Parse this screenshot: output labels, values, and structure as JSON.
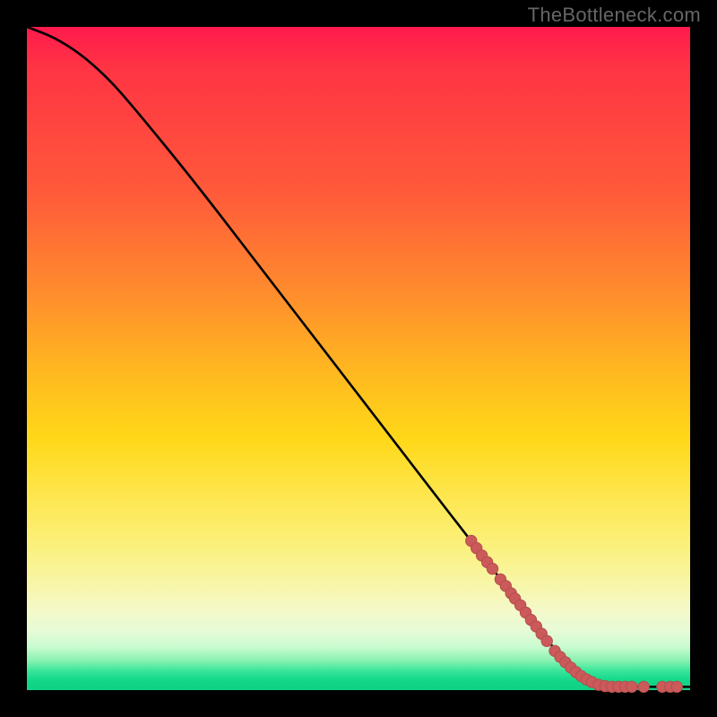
{
  "watermark": "TheBottleneck.com",
  "colors": {
    "curve_stroke": "#000000",
    "dot_fill": "#cc5a5a",
    "dot_stroke": "#b24e4e",
    "gradient_top": "#ff1a4d",
    "gradient_bottom": "#10d185"
  },
  "chart_data": {
    "type": "line",
    "title": "",
    "xlabel": "",
    "ylabel": "",
    "xlim": [
      0,
      100
    ],
    "ylim": [
      0,
      100
    ],
    "curve": [
      {
        "x": 0,
        "y": 100
      },
      {
        "x": 4,
        "y": 98.5
      },
      {
        "x": 8,
        "y": 96
      },
      {
        "x": 12,
        "y": 92.5
      },
      {
        "x": 16,
        "y": 88
      },
      {
        "x": 25,
        "y": 77
      },
      {
        "x": 35,
        "y": 64
      },
      {
        "x": 45,
        "y": 51
      },
      {
        "x": 55,
        "y": 38
      },
      {
        "x": 65,
        "y": 25
      },
      {
        "x": 72,
        "y": 16
      },
      {
        "x": 78,
        "y": 8
      },
      {
        "x": 82,
        "y": 3.5
      },
      {
        "x": 85,
        "y": 1.2
      },
      {
        "x": 88,
        "y": 0.5
      },
      {
        "x": 92,
        "y": 0.5
      },
      {
        "x": 96,
        "y": 0.5
      },
      {
        "x": 100,
        "y": 0.5
      }
    ],
    "dots": [
      {
        "x": 67.0,
        "y": 22.5
      },
      {
        "x": 67.8,
        "y": 21.4
      },
      {
        "x": 68.6,
        "y": 20.3
      },
      {
        "x": 69.4,
        "y": 19.3
      },
      {
        "x": 70.2,
        "y": 18.3
      },
      {
        "x": 71.4,
        "y": 16.7
      },
      {
        "x": 72.2,
        "y": 15.7
      },
      {
        "x": 73.0,
        "y": 14.6
      },
      {
        "x": 73.6,
        "y": 13.8
      },
      {
        "x": 74.4,
        "y": 12.8
      },
      {
        "x": 75.2,
        "y": 11.7
      },
      {
        "x": 76.0,
        "y": 10.6
      },
      {
        "x": 76.8,
        "y": 9.6
      },
      {
        "x": 77.6,
        "y": 8.5
      },
      {
        "x": 78.4,
        "y": 7.4
      },
      {
        "x": 79.6,
        "y": 5.9
      },
      {
        "x": 80.4,
        "y": 5.0
      },
      {
        "x": 81.2,
        "y": 4.2
      },
      {
        "x": 82.0,
        "y": 3.4
      },
      {
        "x": 82.8,
        "y": 2.7
      },
      {
        "x": 83.6,
        "y": 2.1
      },
      {
        "x": 84.4,
        "y": 1.6
      },
      {
        "x": 85.2,
        "y": 1.2
      },
      {
        "x": 86.2,
        "y": 0.8
      },
      {
        "x": 87.2,
        "y": 0.6
      },
      {
        "x": 88.2,
        "y": 0.5
      },
      {
        "x": 89.2,
        "y": 0.5
      },
      {
        "x": 90.2,
        "y": 0.5
      },
      {
        "x": 91.2,
        "y": 0.5
      },
      {
        "x": 93.0,
        "y": 0.5
      },
      {
        "x": 95.8,
        "y": 0.5
      },
      {
        "x": 97.0,
        "y": 0.5
      },
      {
        "x": 98.0,
        "y": 0.5
      }
    ]
  }
}
